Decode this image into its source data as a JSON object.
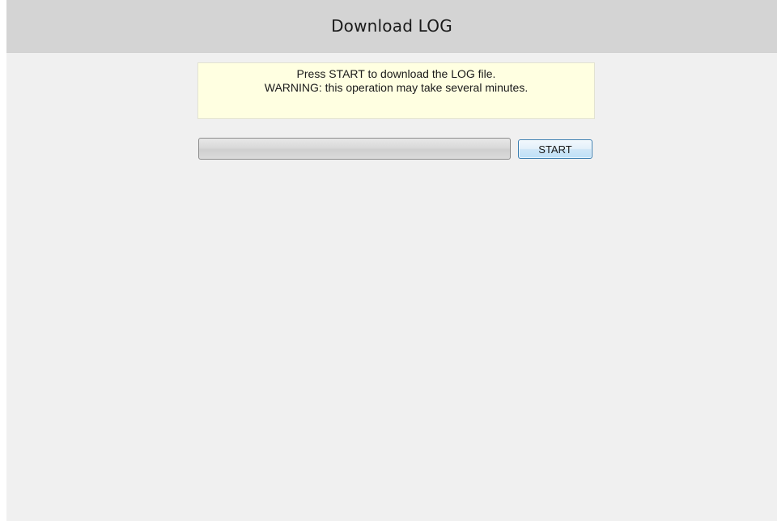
{
  "header": {
    "title": "Download LOG"
  },
  "notice": {
    "line1": "Press START to download the LOG file.",
    "line2": "WARNING: this operation may take several minutes."
  },
  "progress": {
    "value_percent": 0
  },
  "actions": {
    "start_label": "START"
  },
  "colors": {
    "header_bg": "#d4d4d4",
    "page_bg": "#f0f0f0",
    "notice_bg": "#ffffe1"
  }
}
